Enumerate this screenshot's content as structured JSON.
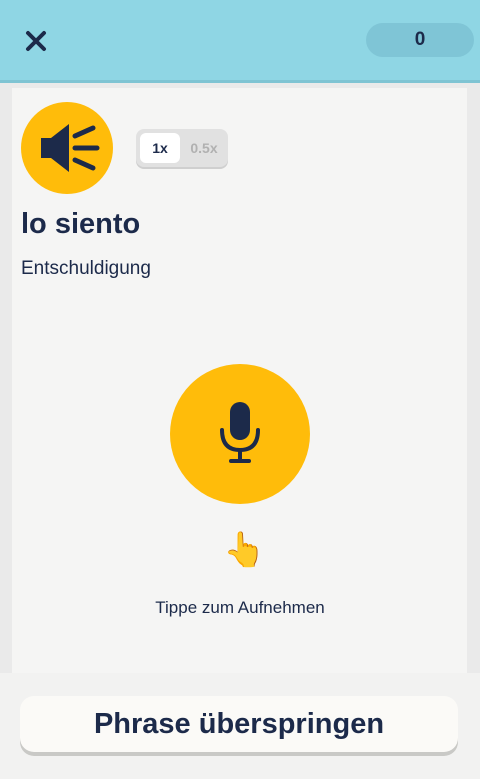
{
  "header": {
    "close_icon": "close-icon",
    "score": "0"
  },
  "speaker": {
    "icon": "speaker-icon",
    "speeds": [
      "1x",
      "0.5x"
    ],
    "selected_speed": "1x"
  },
  "phrase": {
    "text": "lo siento",
    "translation": "Entschuldigung"
  },
  "record": {
    "icon": "microphone-icon",
    "hint_icon": "pointing-hand-icon",
    "hint": "Tippe zum Aufnehmen"
  },
  "footer": {
    "skip_label": "Phrase überspringen"
  },
  "colors": {
    "header_bg": "#8fd6e4",
    "accent": "#ffbc0a",
    "text": "#1c2a4a"
  }
}
